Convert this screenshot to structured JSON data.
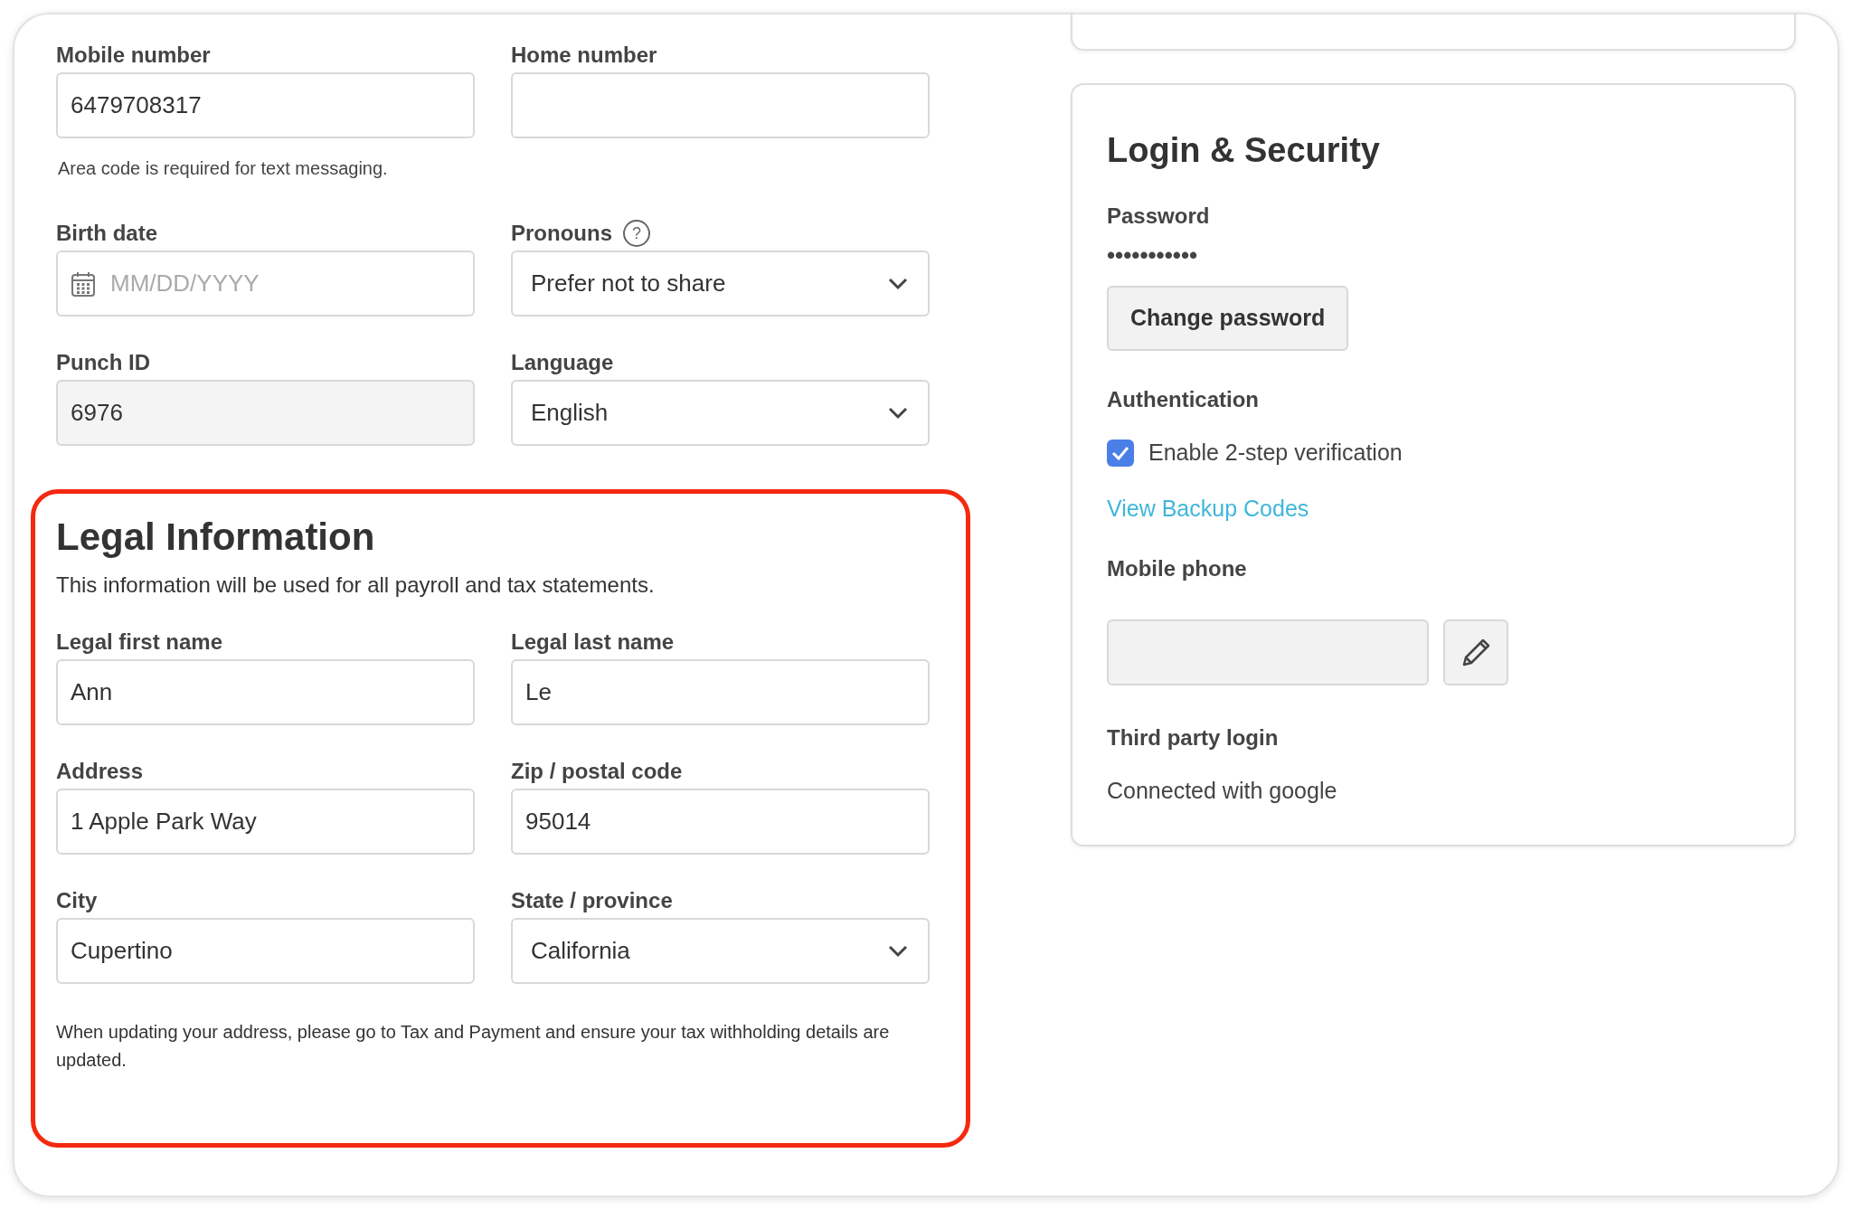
{
  "contact": {
    "fields": [
      {
        "kind": "text",
        "label": "Mobile number",
        "value": "6479708317"
      },
      {
        "kind": "text",
        "label": "Home number"
      }
    ],
    "hint": "Area code is required for text messaging."
  },
  "personal": {
    "fields": [
      {
        "kind": "date",
        "label": "Birth date",
        "placeholder": "MM/DD/YYYY"
      },
      {
        "kind": "select",
        "label": "Pronouns",
        "help": "?",
        "value": "Prefer not to share"
      },
      {
        "kind": "readonly",
        "label": "Punch ID",
        "value": "6976"
      },
      {
        "kind": "select",
        "label": "Language",
        "value": "English"
      }
    ]
  },
  "legal": {
    "title": "Legal Information",
    "description": "This information will be used for all payroll and tax statements.",
    "fields": [
      {
        "kind": "text",
        "label": "Legal first name",
        "value": "Ann"
      },
      {
        "kind": "text",
        "label": "Legal last name",
        "value": "Le"
      },
      {
        "kind": "text",
        "label": "Address",
        "value": "1 Apple Park Way"
      },
      {
        "kind": "text",
        "label": "Zip / postal code",
        "value": "95014"
      },
      {
        "kind": "text",
        "label": "City",
        "value": "Cupertino"
      },
      {
        "kind": "select",
        "label": "State / province",
        "value": "California"
      }
    ],
    "note": "When updating your address, please go to Tax and Payment and ensure your tax withholding details are updated."
  },
  "security": {
    "title": "Login & Security",
    "password_label": "Password",
    "password_mask": "•••••••••••",
    "change_button": "Change password",
    "auth_label": "Authentication",
    "two_step": {
      "label": "Enable 2-step verification",
      "checked": true
    },
    "backup_link": "View Backup Codes",
    "mobile_label": "Mobile phone",
    "mobile_disabled": true,
    "third_party_label": "Third party login",
    "third_party_value": "Connected with google"
  }
}
